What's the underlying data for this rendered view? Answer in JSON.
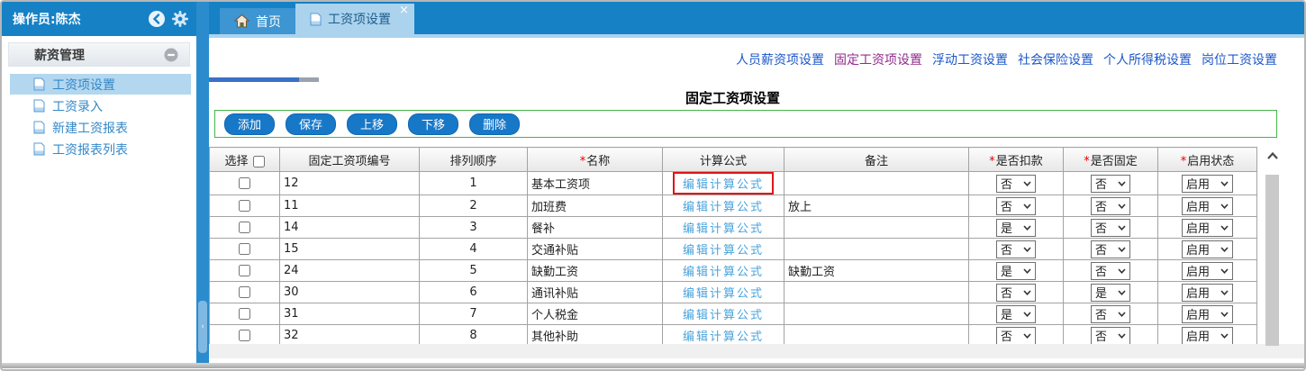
{
  "header": {
    "operator": "操作员:陈杰"
  },
  "sidebar": {
    "group_title": "薪资管理",
    "items": [
      {
        "label": "工资项设置",
        "active": true
      },
      {
        "label": "工资录入",
        "active": false
      },
      {
        "label": "新建工资报表",
        "active": false
      },
      {
        "label": "工资报表列表",
        "active": false
      }
    ]
  },
  "tabs": [
    {
      "label": "首页",
      "active": false
    },
    {
      "label": "工资项设置",
      "active": true,
      "close_label": "×"
    }
  ],
  "nav_links": [
    {
      "label": "人员薪资项设置",
      "active": false
    },
    {
      "label": "固定工资项设置",
      "active": true
    },
    {
      "label": "浮动工资设置",
      "active": false
    },
    {
      "label": "社会保险设置",
      "active": false
    },
    {
      "label": "个人所得税设置",
      "active": false
    },
    {
      "label": "岗位工资设置",
      "active": false
    }
  ],
  "page": {
    "title": "固定工资项设置"
  },
  "toolbar": {
    "buttons": [
      "添加",
      "保存",
      "上移",
      "下移",
      "删除"
    ]
  },
  "table": {
    "formula_link_label": "编辑计算公式",
    "headers": [
      {
        "label": "选择",
        "required": false,
        "checkbox": true
      },
      {
        "label": "固定工资项编号",
        "required": false
      },
      {
        "label": "排列顺序",
        "required": false
      },
      {
        "label": "名称",
        "required": true
      },
      {
        "label": "计算公式",
        "required": false
      },
      {
        "label": "备注",
        "required": false
      },
      {
        "label": "是否扣款",
        "required": true
      },
      {
        "label": "是否固定",
        "required": true
      },
      {
        "label": "启用状态",
        "required": true
      }
    ],
    "rows": [
      {
        "id": "12",
        "order": "1",
        "name": "基本工资项",
        "remark": "",
        "deduct": "否",
        "fixed": "否",
        "status": "启用",
        "highlighted": true
      },
      {
        "id": "11",
        "order": "2",
        "name": "加班费",
        "remark": "放上",
        "deduct": "否",
        "fixed": "否",
        "status": "启用",
        "highlighted": false
      },
      {
        "id": "14",
        "order": "3",
        "name": "餐补",
        "remark": "",
        "deduct": "是",
        "fixed": "否",
        "status": "启用",
        "highlighted": false
      },
      {
        "id": "15",
        "order": "4",
        "name": "交通补贴",
        "remark": "",
        "deduct": "否",
        "fixed": "否",
        "status": "启用",
        "highlighted": false
      },
      {
        "id": "24",
        "order": "5",
        "name": "缺勤工资",
        "remark": "缺勤工资",
        "deduct": "是",
        "fixed": "否",
        "status": "启用",
        "highlighted": false
      },
      {
        "id": "30",
        "order": "6",
        "name": "通讯补贴",
        "remark": "",
        "deduct": "否",
        "fixed": "是",
        "status": "启用",
        "highlighted": false
      },
      {
        "id": "31",
        "order": "7",
        "name": "个人税金",
        "remark": "",
        "deduct": "是",
        "fixed": "否",
        "status": "启用",
        "highlighted": false
      },
      {
        "id": "32",
        "order": "8",
        "name": "其他补助",
        "remark": "",
        "deduct": "否",
        "fixed": "否",
        "status": "启用",
        "highlighted": false
      }
    ]
  },
  "colors": {
    "accent_blue": "#1681c5",
    "active_tab_blue": "#abd3ee",
    "button_blue": "#1878c8",
    "toolbar_border_green": "#44b549",
    "nav_link_blue": "#1c57c8",
    "nav_link_active_purple": "#922b8d",
    "table_link_blue": "#4aa3dc",
    "required_red": "#e00000",
    "highlight_red": "#e01616"
  }
}
